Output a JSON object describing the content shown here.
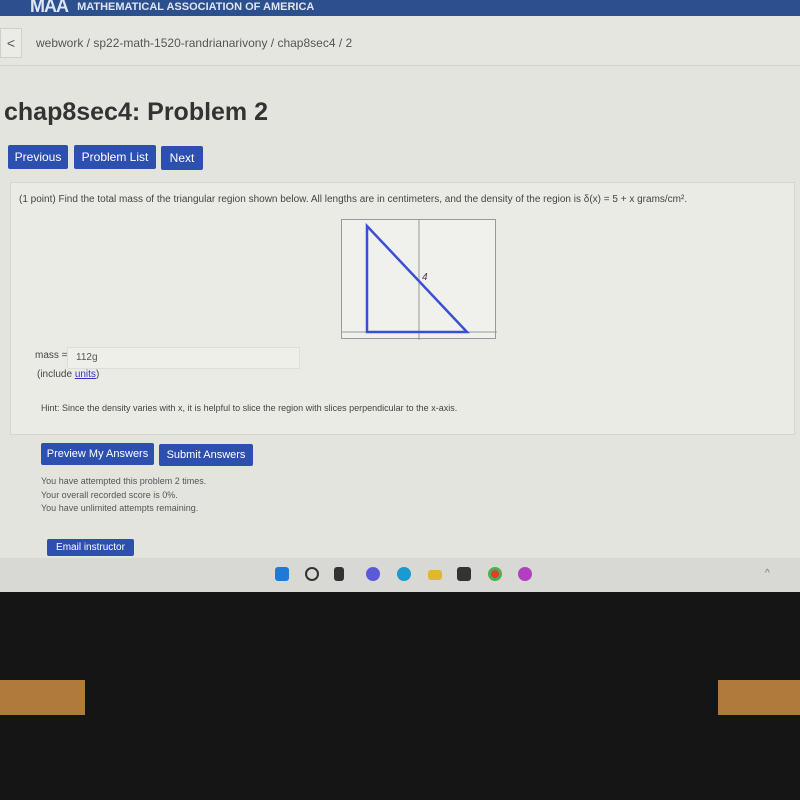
{
  "header": {
    "logo": "MAA",
    "org": "MATHEMATICAL ASSOCIATION OF AMERICA"
  },
  "breadcrumb": {
    "back": "<",
    "path": "webwork / sp22-math-1520-randrianarivony / chap8sec4 / 2"
  },
  "page_title": "chap8sec4: Problem 2",
  "nav": {
    "previous": "Previous",
    "problem_list": "Problem List",
    "next": "Next"
  },
  "problem": {
    "text": "(1 point) Find the total mass of the triangular region shown below. All lengths are in centimeters, and the density of the region is δ(x) = 5 + x grams/cm².",
    "figure_label": "4",
    "answer_label": "mass =",
    "answer_value": "112g",
    "include": "(include ",
    "units_link": "units",
    "include_close": ")",
    "hint": "Hint: Since the density varies with x, it is helpful to slice the region with slices perpendicular to the x-axis."
  },
  "actions": {
    "preview": "Preview My Answers",
    "submit": "Submit Answers",
    "email": "Email instructor"
  },
  "status": [
    "You have attempted this problem 2 times.",
    "Your overall recorded score is 0%.",
    "You have unlimited attempts remaining."
  ],
  "taskbar": {
    "icons": [
      "windows-start",
      "search",
      "task-view",
      "chat",
      "edge",
      "file-explorer",
      "store",
      "chrome",
      "app"
    ]
  },
  "colors": {
    "accent": "#2c4fb0",
    "triangle": "#3a4fd6"
  }
}
